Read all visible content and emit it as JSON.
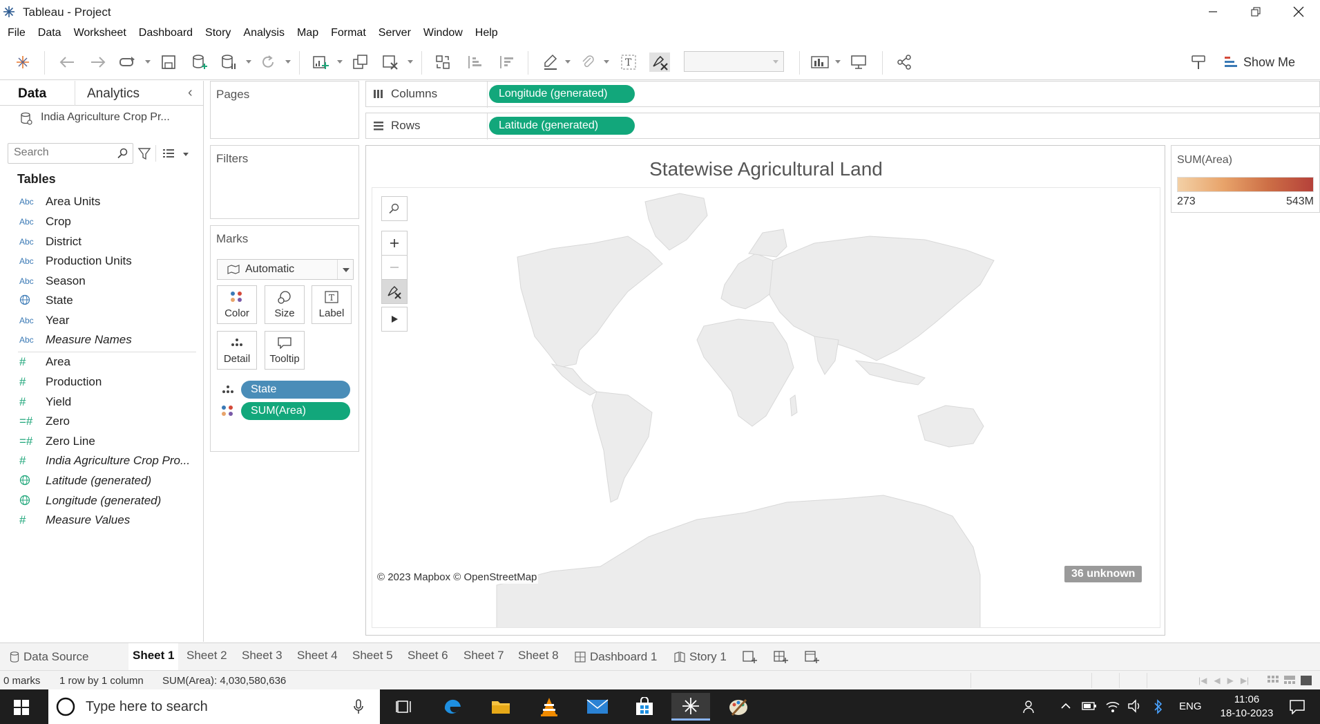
{
  "window": {
    "title": "Tableau - Project"
  },
  "menu": [
    "File",
    "Data",
    "Worksheet",
    "Dashboard",
    "Story",
    "Analysis",
    "Map",
    "Format",
    "Server",
    "Window",
    "Help"
  ],
  "toolbar": {
    "show_me_label": "Show Me"
  },
  "data_pane": {
    "tabs": {
      "data": "Data",
      "analytics": "Analytics"
    },
    "datasource_name": "India Agriculture Crop Pr...",
    "search_placeholder": "Search",
    "tables_label": "Tables",
    "dimensions": [
      {
        "type": "Abc",
        "name": "Area Units",
        "italic": false
      },
      {
        "type": "Abc",
        "name": "Crop",
        "italic": false
      },
      {
        "type": "Abc",
        "name": "District",
        "italic": false
      },
      {
        "type": "Abc",
        "name": "Production Units",
        "italic": false
      },
      {
        "type": "Abc",
        "name": "Season",
        "italic": false
      },
      {
        "type": "globe",
        "name": "State",
        "italic": false
      },
      {
        "type": "Abc",
        "name": "Year",
        "italic": false
      },
      {
        "type": "Abc",
        "name": "Measure Names",
        "italic": true
      }
    ],
    "measures": [
      {
        "type": "#",
        "name": "Area",
        "italic": false
      },
      {
        "type": "#",
        "name": "Production",
        "italic": false
      },
      {
        "type": "#",
        "name": "Yield",
        "italic": false
      },
      {
        "type": "=#",
        "name": "Zero",
        "italic": false
      },
      {
        "type": "=#",
        "name": "Zero Line",
        "italic": false
      },
      {
        "type": "#",
        "name": "India Agriculture Crop Pro...",
        "italic": true
      },
      {
        "type": "globe",
        "name": "Latitude (generated)",
        "italic": true
      },
      {
        "type": "globe",
        "name": "Longitude (generated)",
        "italic": true
      },
      {
        "type": "#",
        "name": "Measure Values",
        "italic": true
      }
    ]
  },
  "cards": {
    "pages": "Pages",
    "filters": "Filters",
    "marks": "Marks",
    "mark_type": "Automatic",
    "mark_buttons": {
      "color": "Color",
      "size": "Size",
      "label": "Label",
      "detail": "Detail",
      "tooltip": "Tooltip"
    },
    "mark_pills": {
      "detail": "State",
      "color": "SUM(Area)"
    }
  },
  "shelves": {
    "columns_label": "Columns",
    "columns_pill": "Longitude (generated)",
    "rows_label": "Rows",
    "rows_pill": "Latitude (generated)"
  },
  "view": {
    "title": "Statewise Agricultural Land",
    "attribution": "© 2023 Mapbox © OpenStreetMap",
    "unknown_badge": "36 unknown"
  },
  "legend": {
    "title": "SUM(Area)",
    "min_label": "273",
    "max_label": "543M",
    "colors": [
      "#f3d0a6",
      "#e8a46b",
      "#cd6f46",
      "#b5413a"
    ]
  },
  "sheet_tabs": {
    "data_source": "Data Source",
    "sheets": [
      "Sheet 1",
      "Sheet 2",
      "Sheet 3",
      "Sheet 4",
      "Sheet 5",
      "Sheet 6",
      "Sheet 7",
      "Sheet 8"
    ],
    "active": "Sheet 1",
    "dashboard": "Dashboard 1",
    "story": "Story 1"
  },
  "status": {
    "marks": "0 marks",
    "dims": "1 row by 1 column",
    "sum": "SUM(Area): 4,030,580,636"
  },
  "taskbar": {
    "search_placeholder": "Type here to search",
    "language": "ENG",
    "time": "11:06",
    "date": "18-10-2023"
  }
}
